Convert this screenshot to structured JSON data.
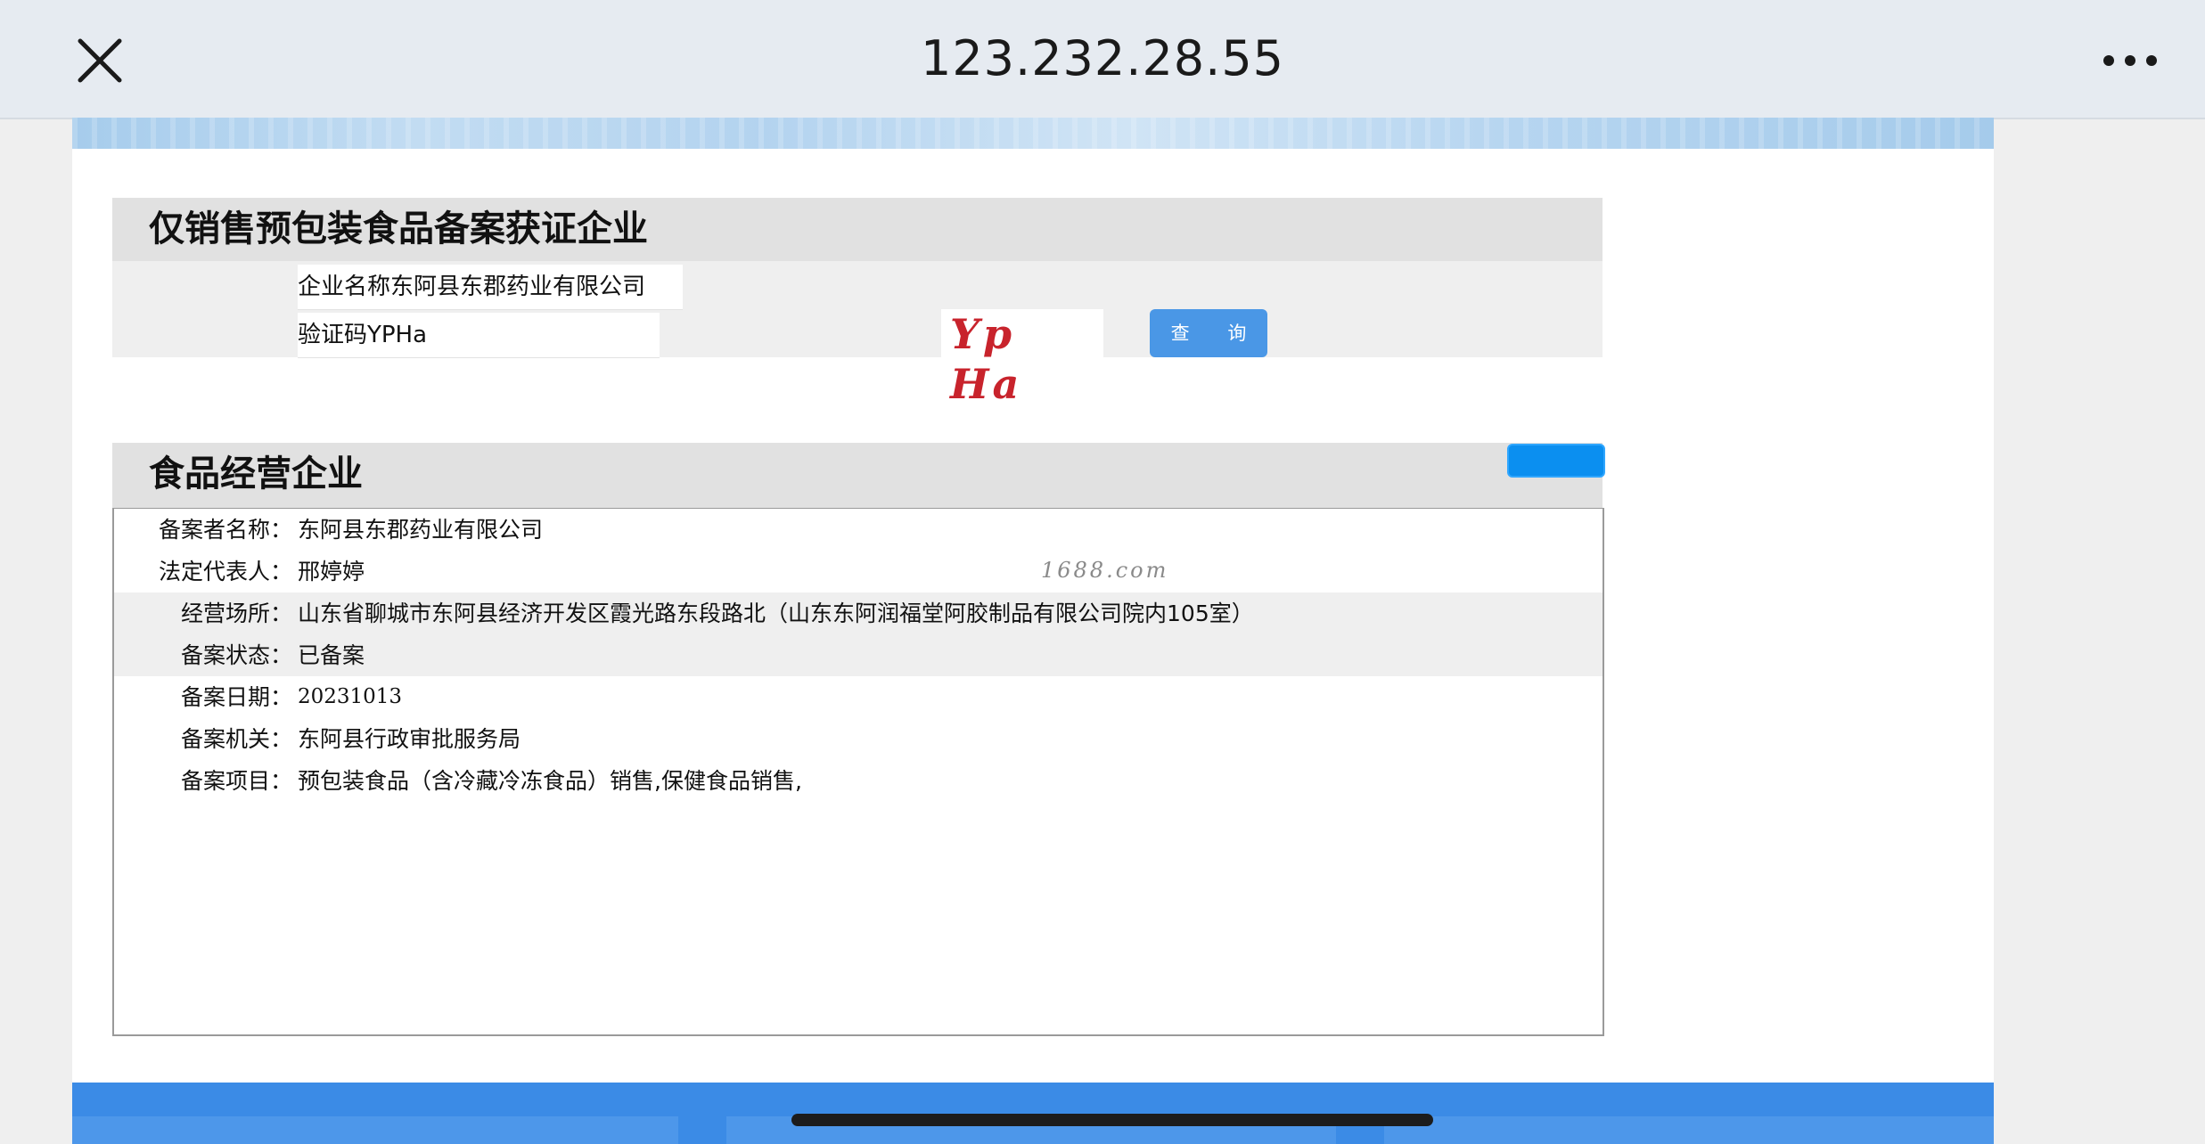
{
  "browser": {
    "url": "123.232.28.55",
    "close_icon": "close-icon",
    "more_icon": "more-horizontal-icon"
  },
  "query_section": {
    "title": "仅销售预包装食品备案获证企业",
    "company_field": "企业名称东阿县东郡药业有限公司",
    "captcha_field": "验证码YPHa",
    "captcha_image_text": "Yp Ha",
    "query_button": "查 询"
  },
  "result_section": {
    "title": "食品经营企业",
    "watermark": "1688.com",
    "rows": [
      {
        "label": "备案者名称：",
        "value": "东阿县东郡药业有限公司"
      },
      {
        "label": "法定代表人：",
        "value": "邢婷婷"
      },
      {
        "label": "经营场所：",
        "value": "山东省聊城市东阿县经济开发区霞光路东段路北（山东东阿润福堂阿胶制品有限公司院内105室）"
      },
      {
        "label": "备案状态：",
        "value": "已备案"
      },
      {
        "label": "备案日期：",
        "value": "20231013"
      },
      {
        "label": "备案机关：",
        "value": "东阿县行政审批服务局"
      },
      {
        "label": "备案项目：",
        "value": "预包装食品（含冷藏冷冻食品）销售,保健食品销售,"
      }
    ]
  },
  "colors": {
    "accent_button": "#4a97e6",
    "pill_button": "#0b8ff0",
    "captcha_text": "#c8232c",
    "footer_blue": "#3b8be6"
  }
}
